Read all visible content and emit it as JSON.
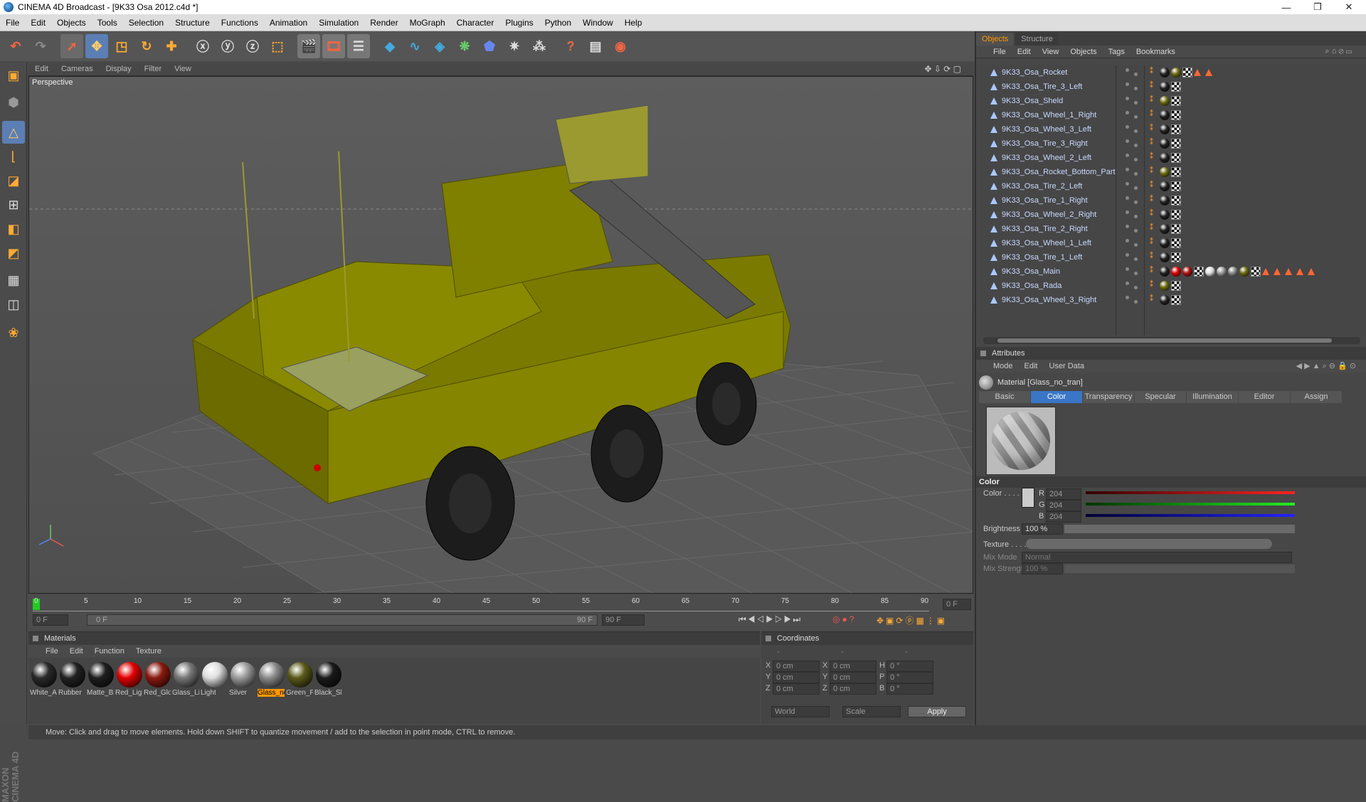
{
  "window": {
    "title": "CINEMA 4D Broadcast - [9K33 Osa 2012.c4d *]",
    "min": "—",
    "max": "❐",
    "close": "✕"
  },
  "menubar": [
    "File",
    "Edit",
    "Objects",
    "Tools",
    "Selection",
    "Structure",
    "Functions",
    "Animation",
    "Simulation",
    "Render",
    "MoGraph",
    "Character",
    "Plugins",
    "Python",
    "Window",
    "Help"
  ],
  "viewport": {
    "menu": [
      "Edit",
      "Cameras",
      "Display",
      "Filter",
      "View"
    ],
    "label": "Perspective"
  },
  "timeline": {
    "ticks": [
      "0",
      "5",
      "10",
      "15",
      "20",
      "25",
      "30",
      "35",
      "40",
      "45",
      "50",
      "55",
      "60",
      "65",
      "70",
      "75",
      "80",
      "85",
      "90"
    ],
    "current_frame": "0 F",
    "start_field": "0 F",
    "range_start": "0 F",
    "range_end": "90 F",
    "end_field": "90 F"
  },
  "materials": {
    "title": "Materials",
    "menu": [
      "File",
      "Edit",
      "Function",
      "Texture"
    ],
    "items": [
      {
        "name": "White_A",
        "color": "#2a2a2a"
      },
      {
        "name": "Rubber",
        "color": "#222222"
      },
      {
        "name": "Matte_Bl",
        "color": "#1e1e1e"
      },
      {
        "name": "Red_Ligi",
        "color": "#e00000"
      },
      {
        "name": "Red_Glo",
        "color": "#8a1a10"
      },
      {
        "name": "Glass_Li",
        "color": "#777777"
      },
      {
        "name": "Light",
        "color": "#dddddd"
      },
      {
        "name": "Silver",
        "color": "#9a9a9a"
      },
      {
        "name": "Glass_nc",
        "color": "#8a8a8a"
      },
      {
        "name": "Green_P",
        "color": "#5a5a1a"
      },
      {
        "name": "Black_Sl",
        "color": "#1a1a1a"
      }
    ],
    "selected_index": 8
  },
  "coordinates": {
    "title": "Coordinates",
    "head": [
      "-",
      "-",
      "-"
    ],
    "rows": [
      {
        "a": "X",
        "av": "0 cm",
        "b": "X",
        "bv": "0 cm",
        "c": "H",
        "cv": "0 °"
      },
      {
        "a": "Y",
        "av": "0 cm",
        "b": "Y",
        "bv": "0 cm",
        "c": "P",
        "cv": "0 °"
      },
      {
        "a": "Z",
        "av": "0 cm",
        "b": "Z",
        "bv": "0 cm",
        "c": "B",
        "cv": "0 °"
      }
    ],
    "world": "World",
    "scale": "Scale",
    "apply": "Apply"
  },
  "status": "Move: Click and drag to move elements. Hold down SHIFT to quantize movement / add to the selection in point mode, CTRL to remove.",
  "objects": {
    "tabs": [
      "Objects",
      "Structure"
    ],
    "menu": [
      "File",
      "Edit",
      "View",
      "Objects",
      "Tags",
      "Bookmarks"
    ],
    "rows": [
      "9K33_Osa_Rocket",
      "9K33_Osa_Tire_3_Left",
      "9K33_Osa_Sheld",
      "9K33_Osa_Wheel_1_Right",
      "9K33_Osa_Wheel_3_Left",
      "9K33_Osa_Tire_3_Right",
      "9K33_Osa_Wheel_2_Left",
      "9K33_Osa_Rocket_Bottom_Part",
      "9K33_Osa_Tire_2_Left",
      "9K33_Osa_Tire_1_Right",
      "9K33_Osa_Wheel_2_Right",
      "9K33_Osa_Tire_2_Right",
      "9K33_Osa_Wheel_1_Left",
      "9K33_Osa_Tire_1_Left",
      "9K33_Osa_Main",
      "9K33_Osa_Rada",
      "9K33_Osa_Wheel_3_Right"
    ]
  },
  "attributes": {
    "title": "Attributes",
    "menu": [
      "Mode",
      "Edit",
      "User Data"
    ],
    "material": "Material [Glass_no_tran]",
    "tabs": [
      "Basic",
      "Color",
      "Transparency",
      "Specular",
      "Illumination",
      "Editor",
      "Assign"
    ],
    "active_tab": "Color",
    "section": "Color",
    "color_label": "Color . . . .",
    "r_label": "R",
    "r": "204",
    "g_label": "G",
    "g": "204",
    "b_label": "B",
    "b": "204",
    "brightness_label": "Brightness",
    "brightness": "100 %",
    "texture_label": "Texture . . . .",
    "mixmode_label": "Mix Mode",
    "mixmode": "Normal",
    "mixstrength_label": "Mix Strength",
    "mixstrength": "100 %"
  }
}
